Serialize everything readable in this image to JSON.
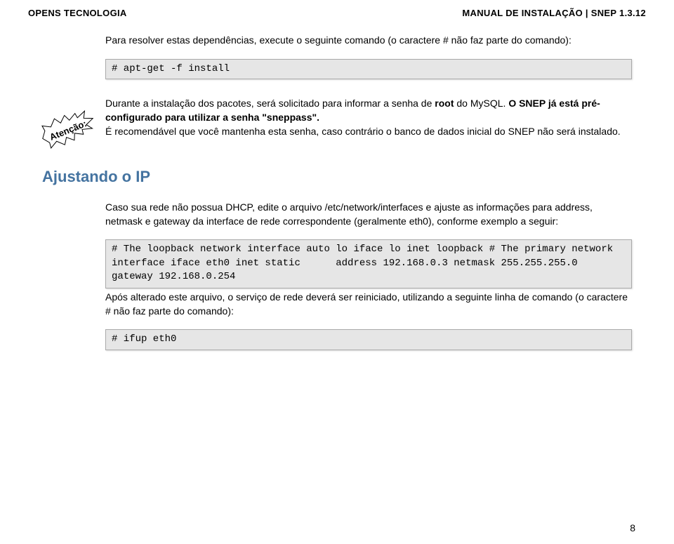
{
  "header": {
    "left": "OPENS TECNOLOGIA",
    "right": "MANUAL DE INSTALAÇÃO | SNEP 1.3.12"
  },
  "intro": {
    "p1": "Para resolver estas dependências, execute o seguinte comando  (o caractere # não faz parte do comando):",
    "code1": "# apt-get -f install"
  },
  "attention": {
    "label": "Atenção:",
    "part1": "Durante a instalação dos pacotes, será solicitado para informar a senha de ",
    "part2_bold": "root",
    "part3": " do MySQL. ",
    "part4_bold": "O SNEP já está pré-configurado para utilizar a senha \"sneppass\".",
    "part5": "É recomendável que você mantenha esta senha, caso contrário o banco de dados inicial do SNEP não será instalado."
  },
  "section": {
    "title": "Ajustando o IP"
  },
  "ip": {
    "p1": "Caso sua rede não possua DHCP, edite o arquivo /etc/network/interfaces e ajuste as informações para address, netmask e gateway da interface de rede correspondente (geralmente eth0), conforme exemplo a seguir:",
    "code2": "# The loopback network interface auto lo iface lo inet loopback # The primary network interface iface eth0 inet static      address 192.168.0.3 netmask 255.255.255.0\ngateway 192.168.0.254",
    "p2": "Após alterado este arquivo, o serviço de rede deverá ser reiniciado, utilizando a seguinte linha de comando  (o caractere # não faz parte do comando):",
    "code3": "# ifup eth0"
  },
  "page": "8"
}
